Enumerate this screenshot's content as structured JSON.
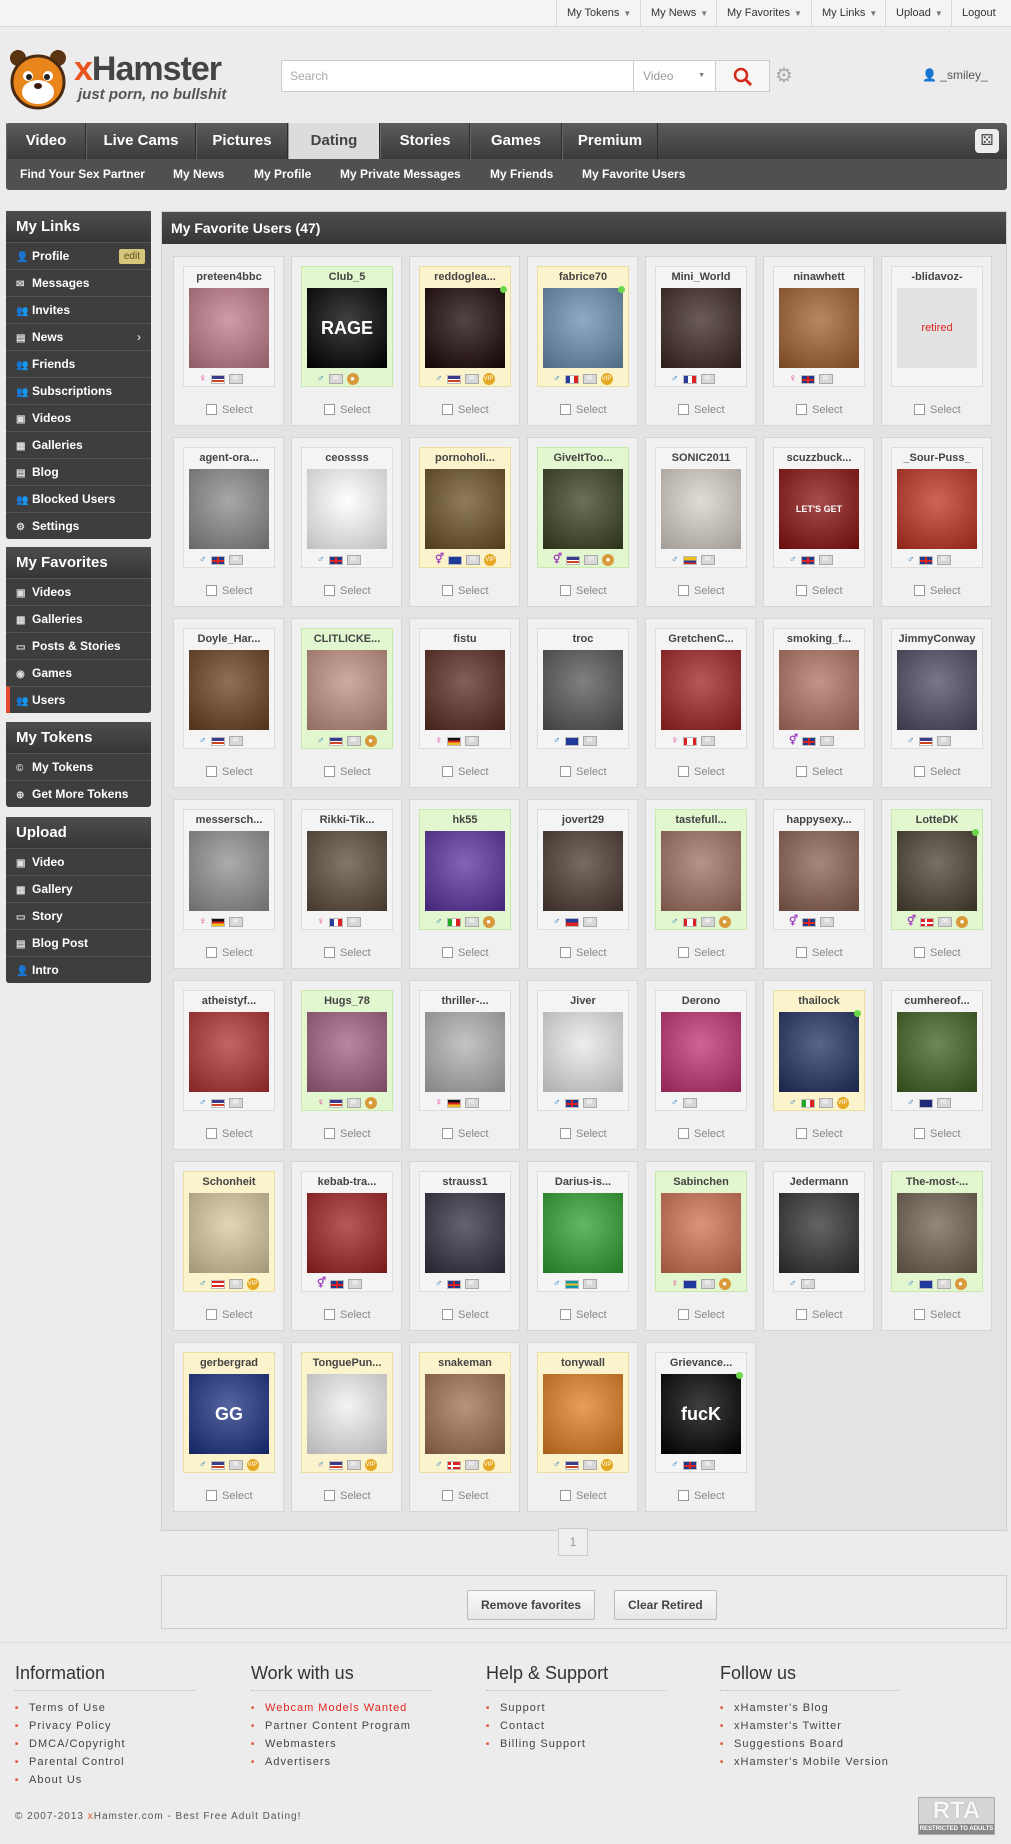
{
  "topbar": {
    "links": [
      "My Tokens",
      "My News",
      "My Favorites",
      "My Links",
      "Upload",
      "Logout"
    ]
  },
  "header": {
    "logo_main": "Hamster",
    "logo_x": "x",
    "logo_tagline": "just porn, no bullshit",
    "search_placeholder": "Search",
    "search_category": "Video",
    "username": "_smiley_"
  },
  "nav": {
    "tabs": [
      "Video",
      "Live Cams",
      "Pictures",
      "Dating",
      "Stories",
      "Games",
      "Premium"
    ],
    "active": "Dating",
    "subtabs": [
      "Find Your Sex Partner",
      "My News",
      "My Profile",
      "My Private Messages",
      "My Friends",
      "My Favorite Users"
    ]
  },
  "sidebar": {
    "links_title": "My Links",
    "edit_label": "edit",
    "links": [
      "Profile",
      "Messages",
      "Invites",
      "News",
      "Friends",
      "Subscriptions",
      "Videos",
      "Galleries",
      "Blog",
      "Blocked Users",
      "Settings"
    ],
    "fav_title": "My Favorites",
    "favorites": [
      "Videos",
      "Galleries",
      "Posts & Stories",
      "Games",
      "Users"
    ],
    "tokens_title": "My Tokens",
    "tokens": [
      "My Tokens",
      "Get More Tokens"
    ],
    "upload_title": "Upload",
    "upload": [
      "Video",
      "Gallery",
      "Story",
      "Blog Post",
      "Intro"
    ]
  },
  "panel": {
    "title": "My Favorite Users (47)",
    "select_label": "Select",
    "page": "1",
    "retired_label": "retired"
  },
  "users": [
    {
      "name": "preteen4bbc",
      "bg": "none",
      "av": "#c07a8a",
      "gender": "♀",
      "flag": "us"
    },
    {
      "name": "Club_5",
      "bg": "green",
      "av": "#000000",
      "gender": "♂",
      "flag": "",
      "text": "RAGE",
      "bear": true
    },
    {
      "name": "reddoglea...",
      "bg": "yellow",
      "av": "#1a0505",
      "gender": "♂",
      "flag": "us",
      "vip": true,
      "online": true
    },
    {
      "name": "fabrice70",
      "bg": "yellow",
      "av": "#6a8fb0",
      "gender": "♂",
      "flag": "fr",
      "vip": true,
      "online": true
    },
    {
      "name": "Mini_World",
      "bg": "none",
      "av": "#3a2620",
      "gender": "♂",
      "flag": "fr"
    },
    {
      "name": "ninawhett",
      "bg": "none",
      "av": "#a06030",
      "gender": "♀",
      "flag": "gb"
    },
    {
      "name": "-blidavoz-",
      "bg": "none",
      "av": "retired"
    },
    {
      "name": "agent-ora...",
      "bg": "none",
      "av": "#8a8a8a",
      "gender": "♂",
      "flag": "gb"
    },
    {
      "name": "ceossss",
      "bg": "none",
      "av": "#ffffff",
      "gender": "♂",
      "flag": "gb"
    },
    {
      "name": "pornoholi...",
      "bg": "yellow",
      "av": "#6a5020",
      "gender": "⚥",
      "flag": "eu",
      "vip": true
    },
    {
      "name": "GiveItToo...",
      "bg": "green",
      "av": "#3a4020",
      "gender": "⚥",
      "flag": "us",
      "bear": true
    },
    {
      "name": "SONIC2011",
      "bg": "none",
      "av": "#d8d0c8",
      "gender": "♂",
      "flag": "co"
    },
    {
      "name": "scuzzbuck...",
      "bg": "none",
      "av": "#8a1010",
      "gender": "♂",
      "flag": "gb",
      "text": "LET'S GET FUCKED"
    },
    {
      "name": "_Sour-Puss_",
      "bg": "none",
      "av": "#c03020",
      "gender": "♂",
      "flag": "gb"
    },
    {
      "name": "Doyle_Har...",
      "bg": "none",
      "av": "#6a4020",
      "gender": "♂",
      "flag": "us"
    },
    {
      "name": "CLITLICKE...",
      "bg": "green",
      "av": "#c09080",
      "gender": "♂",
      "flag": "us",
      "bear": true
    },
    {
      "name": "fistu",
      "bg": "none",
      "av": "#5a2a20",
      "gender": "♀",
      "flag": "de"
    },
    {
      "name": "troc",
      "bg": "none",
      "av": "#555555",
      "gender": "♂",
      "flag": "eu"
    },
    {
      "name": "GretchenC...",
      "bg": "none",
      "av": "#a02020",
      "gender": "♀",
      "flag": "ca"
    },
    {
      "name": "smoking_f...",
      "bg": "none",
      "av": "#b07060",
      "gender": "⚥",
      "flag": "gb"
    },
    {
      "name": "JimmyConway",
      "bg": "none",
      "av": "#4a4a60",
      "gender": "♂",
      "flag": "us"
    },
    {
      "name": "messersch...",
      "bg": "none",
      "av": "#909090",
      "gender": "♀",
      "flag": "de"
    },
    {
      "name": "Rikki-Tik...",
      "bg": "none",
      "av": "#5a4a3a",
      "gender": "♀",
      "flag": "fr"
    },
    {
      "name": "hk55",
      "bg": "green",
      "av": "#5a30a0",
      "gender": "♂",
      "flag": "it",
      "bear": true
    },
    {
      "name": "jovert29",
      "bg": "none",
      "av": "#4a3a30",
      "gender": "♂",
      "flag": "ph"
    },
    {
      "name": "tastefull...",
      "bg": "green",
      "av": "#a07060",
      "gender": "♂",
      "flag": "ca",
      "bear": true
    },
    {
      "name": "happysexy...",
      "bg": "none",
      "av": "#8a6050",
      "gender": "⚥",
      "flag": "gb"
    },
    {
      "name": "LotteDK",
      "bg": "green",
      "av": "#4a4030",
      "gender": "⚥",
      "flag": "dk",
      "bear": true,
      "online": true
    },
    {
      "name": "atheistyf...",
      "bg": "none",
      "av": "#b03030",
      "gender": "♂",
      "flag": "us"
    },
    {
      "name": "Hugs_78",
      "bg": "green",
      "av": "#a06080",
      "gender": "♀",
      "flag": "us",
      "bear": true
    },
    {
      "name": "thriller-...",
      "bg": "none",
      "av": "#b0b0b0",
      "gender": "♀",
      "flag": "de"
    },
    {
      "name": "Jiver",
      "bg": "none",
      "av": "#e8e8e8",
      "gender": "♂",
      "flag": "gb"
    },
    {
      "name": "Derono",
      "bg": "none",
      "av": "#c03070",
      "gender": "♂",
      "flag": ""
    },
    {
      "name": "thailock",
      "bg": "yellow",
      "av": "#203060",
      "gender": "♂",
      "flag": "it",
      "vip": true,
      "online": true
    },
    {
      "name": "cumhereof...",
      "bg": "none",
      "av": "#406020",
      "gender": "♂",
      "flag": "au"
    },
    {
      "name": "Schonheit",
      "bg": "yellow",
      "av": "#d8c8a0",
      "gender": "♂",
      "flag": "pr",
      "vip": true
    },
    {
      "name": "kebab-tra...",
      "bg": "none",
      "av": "#a02020",
      "gender": "⚥",
      "flag": "gb"
    },
    {
      "name": "strauss1",
      "bg": "none",
      "av": "#303040",
      "gender": "♂",
      "flag": "gb"
    },
    {
      "name": "Darius-is...",
      "bg": "none",
      "av": "#30a030",
      "gender": "♂",
      "flag": "bs"
    },
    {
      "name": "Sabinchen",
      "bg": "green",
      "av": "#d07050",
      "gender": "♀",
      "flag": "eu",
      "bear": true
    },
    {
      "name": "Jedermann",
      "bg": "none",
      "av": "#303030",
      "gender": "♂",
      "flag": ""
    },
    {
      "name": "The-most-...",
      "bg": "green",
      "av": "#706050",
      "gender": "♂",
      "flag": "eu",
      "bear": true
    },
    {
      "name": "gerbergrad",
      "bg": "yellow",
      "av": "#1a3080",
      "gender": "♂",
      "flag": "us",
      "vip": true,
      "text": "GG"
    },
    {
      "name": "TonguePun...",
      "bg": "yellow",
      "av": "#f0f0f0",
      "gender": "♂",
      "flag": "us",
      "vip": true
    },
    {
      "name": "snakeman",
      "bg": "yellow",
      "av": "#a07050",
      "gender": "♂",
      "flag": "dk",
      "vip": true
    },
    {
      "name": "tonywall",
      "bg": "yellow",
      "av": "#e08020",
      "gender": "♂",
      "flag": "us",
      "vip": true
    },
    {
      "name": "Grievance...",
      "bg": "none",
      "av": "#000000",
      "gender": "♂",
      "flag": "gb",
      "text": "fucK",
      "online": true
    }
  ],
  "actions": {
    "remove": "Remove favorites",
    "clear": "Clear Retired"
  },
  "footer": {
    "cols": [
      {
        "title": "Information",
        "links": [
          "Terms of Use",
          "Privacy Policy",
          "DMCA/Copyright",
          "Parental Control",
          "About Us"
        ]
      },
      {
        "title": "Work with us",
        "links": [
          "Webcam Models Wanted",
          "Partner Content Program",
          "Webmasters",
          "Advertisers"
        ]
      },
      {
        "title": "Help & Support",
        "links": [
          "Support",
          "Contact",
          "Billing Support"
        ]
      },
      {
        "title": "Follow us",
        "links": [
          "xHamster's Blog",
          "xHamster's Twitter",
          "Suggestions Board",
          "xHamster's Mobile Version"
        ]
      }
    ],
    "copy_pre": "© 2007-2013 ",
    "copy_x": "x",
    "copy_post": "Hamster.com - Best Free Adult Dating!",
    "rta_big": "RTA",
    "rta_small": "RESTRICTED TO ADULTS"
  },
  "colors": {
    "accent": "#e34b2f",
    "online": "#6bd84a",
    "vip": "#e6a822"
  }
}
